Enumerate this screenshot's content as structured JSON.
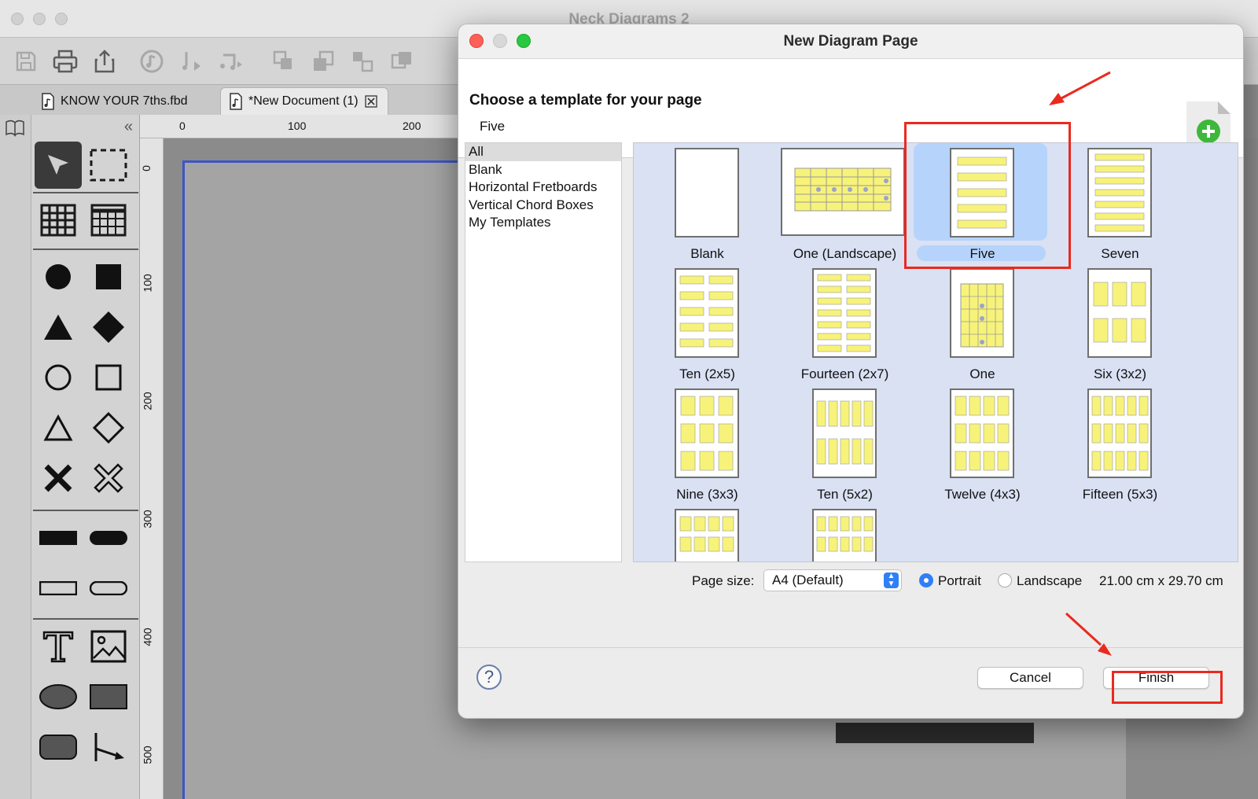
{
  "app": {
    "title": "Neck Diagrams 2"
  },
  "tabs": [
    {
      "label": "KNOW YOUR 7ths.fbd"
    },
    {
      "label": "*New Document (1)"
    }
  ],
  "side_toolbar": {
    "collapse_icon": "«"
  },
  "rulers": {
    "top": [
      "0",
      "100",
      "200"
    ],
    "left": [
      "0",
      "100",
      "200",
      "300",
      "400",
      "500"
    ]
  },
  "dialog": {
    "title": "New Diagram Page",
    "header_title": "Choose a template for your page",
    "selected_template": "Five",
    "categories": [
      "All",
      "Blank",
      "Horizontal Fretboards",
      "Vertical Chord Boxes",
      "My Templates"
    ],
    "templates": [
      "Blank",
      "One (Landscape)",
      "Five",
      "Seven",
      "Ten (2x5)",
      "Fourteen (2x7)",
      "One",
      "Six (3x2)",
      "Nine (3x3)",
      "Ten (5x2)",
      "Twelve (4x3)",
      "Fifteen (5x3)"
    ],
    "page_size_label": "Page size:",
    "page_size_value": "A4 (Default)",
    "orientation": {
      "portrait": "Portrait",
      "landscape": "Landscape",
      "selected": "portrait"
    },
    "dimensions": "21.00 cm x 29.70 cm",
    "help_label": "?",
    "cancel": "Cancel",
    "finish": "Finish"
  },
  "colors": {
    "accent": "#2f7ff7",
    "annotation": "#ea2a1f",
    "selection": "#b6d4fb",
    "fretboard": "#f7f37a"
  }
}
